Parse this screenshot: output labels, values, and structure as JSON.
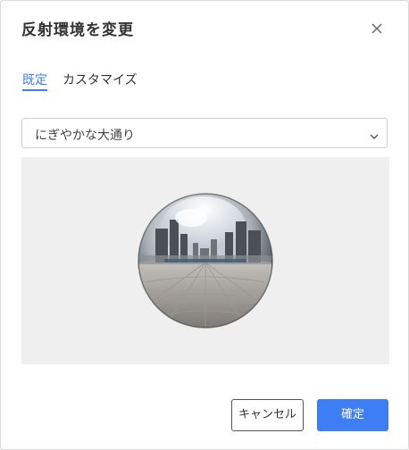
{
  "dialog": {
    "title": "反射環境を変更",
    "close_icon": "close-icon"
  },
  "tabs": [
    {
      "label": "既定",
      "active": true
    },
    {
      "label": "カスタマイズ",
      "active": false
    }
  ],
  "environment_select": {
    "value": "にぎやかな大通り",
    "icon": "chevron-down-icon"
  },
  "buttons": {
    "cancel_label": "キャンセル",
    "confirm_label": "確定"
  },
  "colors": {
    "accent": "#3d7ef5",
    "preview_background": "#efefef",
    "text": "#333333"
  }
}
